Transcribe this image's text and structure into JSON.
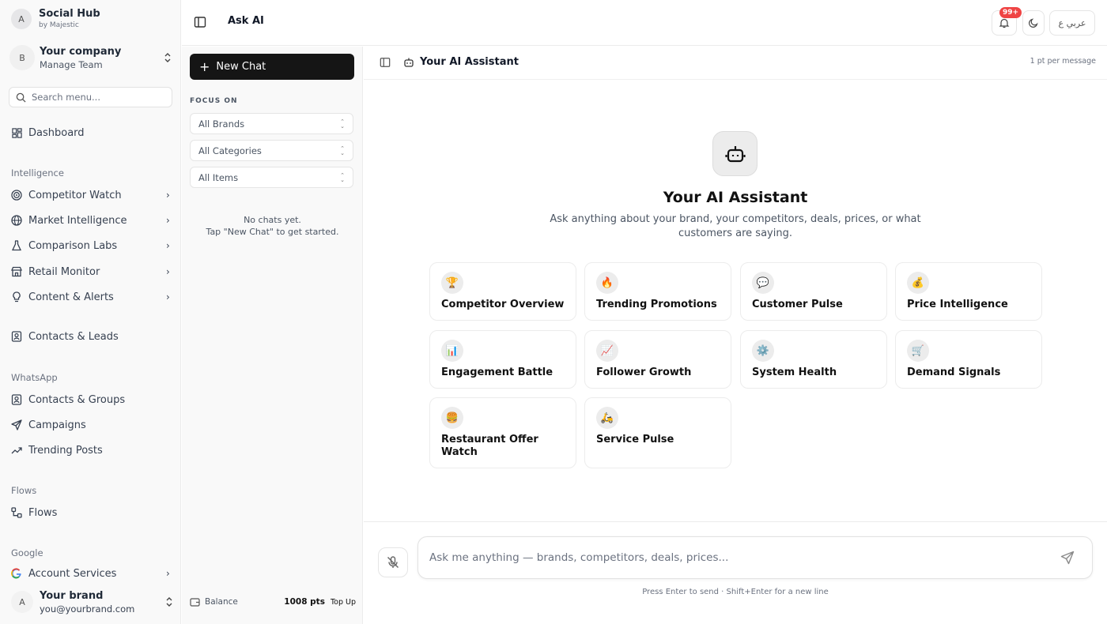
{
  "app": {
    "name": "Social Hub",
    "by": "by Majestic",
    "avatar_letter": "A"
  },
  "company": {
    "avatar_letter": "B",
    "name": "Your company",
    "sub": "Manage Team"
  },
  "search": {
    "placeholder": "Search menu..."
  },
  "nav": {
    "dashboard": "Dashboard",
    "sections": {
      "intelligence": "Intelligence",
      "whatsapp": "WhatsApp",
      "flows": "Flows",
      "google": "Google"
    },
    "intelligence_items": [
      "Competitor Watch",
      "Market Intelligence",
      "Comparison Labs",
      "Retail Monitor",
      "Content & Alerts"
    ],
    "contacts_leads": "Contacts & Leads",
    "whatsapp_items": [
      "Contacts & Groups",
      "Campaigns",
      "Trending Posts"
    ],
    "flows_item": "Flows",
    "google_item": "Account Services"
  },
  "user": {
    "avatar_letter": "A",
    "name": "Your brand",
    "email": "you@yourbrand.com"
  },
  "topbar": {
    "title": "Ask AI",
    "notification_badge": "99+",
    "language_button": "عربي ع"
  },
  "chatlist": {
    "new_chat": "New Chat",
    "focus_label": "FOCUS ON",
    "filters": [
      "All Brands",
      "All Categories",
      "All Items"
    ],
    "empty_line1": "No chats yet.",
    "empty_line2": "Tap \"New Chat\" to get started.",
    "balance_label": "Balance",
    "balance_points": "1008 pts",
    "top_up": "Top Up"
  },
  "main": {
    "header_title": "Your AI Assistant",
    "cost": "1 pt per message",
    "hero_title": "Your AI Assistant",
    "hero_sub": "Ask anything about your brand, your competitors, deals, prices, or what customers are saying.",
    "cards": [
      {
        "emoji": "🏆",
        "title": "Competitor Overview"
      },
      {
        "emoji": "🔥",
        "title": "Trending Promotions"
      },
      {
        "emoji": "💬",
        "title": "Customer Pulse"
      },
      {
        "emoji": "💰",
        "title": "Price Intelligence"
      },
      {
        "emoji": "📊",
        "title": "Engagement Battle"
      },
      {
        "emoji": "📈",
        "title": "Follower Growth"
      },
      {
        "emoji": "⚙️",
        "title": "System Health"
      },
      {
        "emoji": "🛒",
        "title": "Demand Signals"
      },
      {
        "emoji": "🍔",
        "title": "Restaurant Offer Watch"
      },
      {
        "emoji": "🛵",
        "title": "Service Pulse"
      }
    ],
    "composer_placeholder": "Ask me anything — brands, competitors, deals, prices...",
    "hint": "Press Enter to send · Shift+Enter for a new line"
  }
}
